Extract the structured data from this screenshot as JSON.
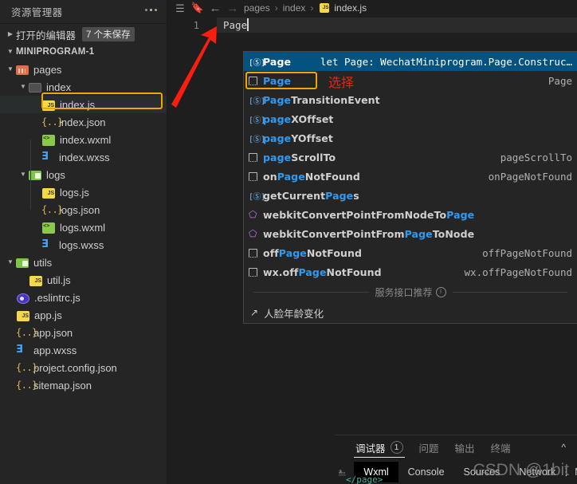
{
  "sidebar": {
    "title": "资源管理器",
    "more_icon": "ellipsis-icon",
    "open_editors": {
      "label": "打开的编辑器",
      "badge": "7 个未保存"
    },
    "project": {
      "label": "MINIPROGRAM-1"
    },
    "tree": [
      {
        "label": "pages",
        "icon": "folder-pages-icon",
        "indent": 1,
        "twisty": "down"
      },
      {
        "label": "index",
        "icon": "folder-plain-icon",
        "indent": 2,
        "twisty": "down"
      },
      {
        "label": "index.js",
        "icon": "js-icon",
        "indent": 3,
        "twisty": "blank",
        "selected": true
      },
      {
        "label": "index.json",
        "icon": "json-icon",
        "indent": 3,
        "twisty": "blank"
      },
      {
        "label": "index.wxml",
        "icon": "wxml-icon",
        "indent": 3,
        "twisty": "blank"
      },
      {
        "label": "index.wxss",
        "icon": "wxss-icon",
        "indent": 3,
        "twisty": "blank"
      },
      {
        "label": "logs",
        "icon": "folder-green-icon",
        "indent": 2,
        "twisty": "down"
      },
      {
        "label": "logs.js",
        "icon": "js-icon",
        "indent": 3,
        "twisty": "blank"
      },
      {
        "label": "logs.json",
        "icon": "json-icon",
        "indent": 3,
        "twisty": "blank"
      },
      {
        "label": "logs.wxml",
        "icon": "wxml-icon",
        "indent": 3,
        "twisty": "blank"
      },
      {
        "label": "logs.wxss",
        "icon": "wxss-icon",
        "indent": 3,
        "twisty": "blank"
      },
      {
        "label": "utils",
        "icon": "folder-green-icon",
        "indent": 1,
        "twisty": "down"
      },
      {
        "label": "util.js",
        "icon": "js-icon",
        "indent": 2,
        "twisty": "blank"
      },
      {
        "label": ".eslintrc.js",
        "icon": "eslint-icon",
        "indent": 1,
        "twisty": "blank"
      },
      {
        "label": "app.js",
        "icon": "js-icon",
        "indent": 1,
        "twisty": "blank"
      },
      {
        "label": "app.json",
        "icon": "json-icon",
        "indent": 1,
        "twisty": "blank"
      },
      {
        "label": "app.wxss",
        "icon": "wxss-icon",
        "indent": 1,
        "twisty": "blank"
      },
      {
        "label": "project.config.json",
        "icon": "json-icon",
        "indent": 1,
        "twisty": "blank"
      },
      {
        "label": "sitemap.json",
        "icon": "json-icon",
        "indent": 1,
        "twisty": "blank"
      }
    ]
  },
  "breadcrumb": {
    "icons": [
      "outline-list-icon",
      "bookmark-icon",
      "back-arrow-icon",
      "forward-arrow-icon"
    ],
    "crumbs": [
      "pages",
      "index",
      "index.js"
    ],
    "separator": "›",
    "file_icon": "js-icon"
  },
  "editor": {
    "line_number": "1",
    "line_text": "Page"
  },
  "autocomplete": {
    "items": [
      {
        "icon": "reference-icon",
        "pre": "",
        "match": "Page",
        "post": "",
        "detail": "let Page: WechatMiniprogram.Page.Construc…",
        "selected": true
      },
      {
        "icon": "snippet-box-icon",
        "pre": "",
        "match": "Page",
        "post": "",
        "detail": "Page",
        "highlighted": true
      },
      {
        "icon": "reference-icon",
        "pre": "",
        "match": "Page",
        "post": "TransitionEvent",
        "detail": ""
      },
      {
        "icon": "reference-icon",
        "pre": "",
        "match": "page",
        "post": "XOffset",
        "detail": ""
      },
      {
        "icon": "reference-icon",
        "pre": "",
        "match": "page",
        "post": "YOffset",
        "detail": ""
      },
      {
        "icon": "snippet-box-icon",
        "pre": "",
        "match": "page",
        "post": "ScrollTo",
        "detail": "pageScrollTo"
      },
      {
        "icon": "snippet-box-icon",
        "pre": "on",
        "match": "Page",
        "post": "NotFound",
        "detail": "onPageNotFound"
      },
      {
        "icon": "reference-icon",
        "pre": "getCurrent",
        "match": "Page",
        "post": "s",
        "detail": ""
      },
      {
        "icon": "cube-icon",
        "pre": "webkitConvertPointFromNodeTo",
        "match": "Page",
        "post": "",
        "detail": ""
      },
      {
        "icon": "cube-icon",
        "pre": "webkitConvertPointFrom",
        "match": "Page",
        "post": "ToNode",
        "detail": ""
      },
      {
        "icon": "snippet-box-icon",
        "pre": "off",
        "match": "Page",
        "post": "NotFound",
        "detail": "offPageNotFound"
      },
      {
        "icon": "snippet-box-icon",
        "pre": "wx.off",
        "match": "Page",
        "post": "NotFound",
        "detail": "wx.offPageNotFound"
      }
    ],
    "divider_label": "服务接口推荐",
    "divider_info_icon": "info-circle-icon",
    "service_item": {
      "label": "人脸年龄变化",
      "icon": "external-link-icon"
    }
  },
  "annotation": {
    "select_text": "选择",
    "arrow_color": "#fa1e0e",
    "highlight_color": "#f0a500"
  },
  "panel": {
    "tabs": [
      {
        "label": "调试器",
        "badge": "1",
        "active": true
      },
      {
        "label": "问题",
        "active": false
      },
      {
        "label": "输出",
        "active": false
      },
      {
        "label": "终端",
        "active": false
      }
    ],
    "collapse_icon": "chevron-up-icon",
    "devtools": {
      "inspect_icon": "inspect-cursor-icon",
      "tabs": [
        "Wxml",
        "Console",
        "Sources",
        "Network",
        "Memory"
      ],
      "active_tab": "Wxml",
      "more_icon": "chevron-double-right-icon",
      "settings_icon": "gear-icon",
      "kebab_icon": "kebab-menu-icon",
      "code_tail": "</page>"
    }
  },
  "watermark": {
    "text": "CSDN @1bit"
  }
}
